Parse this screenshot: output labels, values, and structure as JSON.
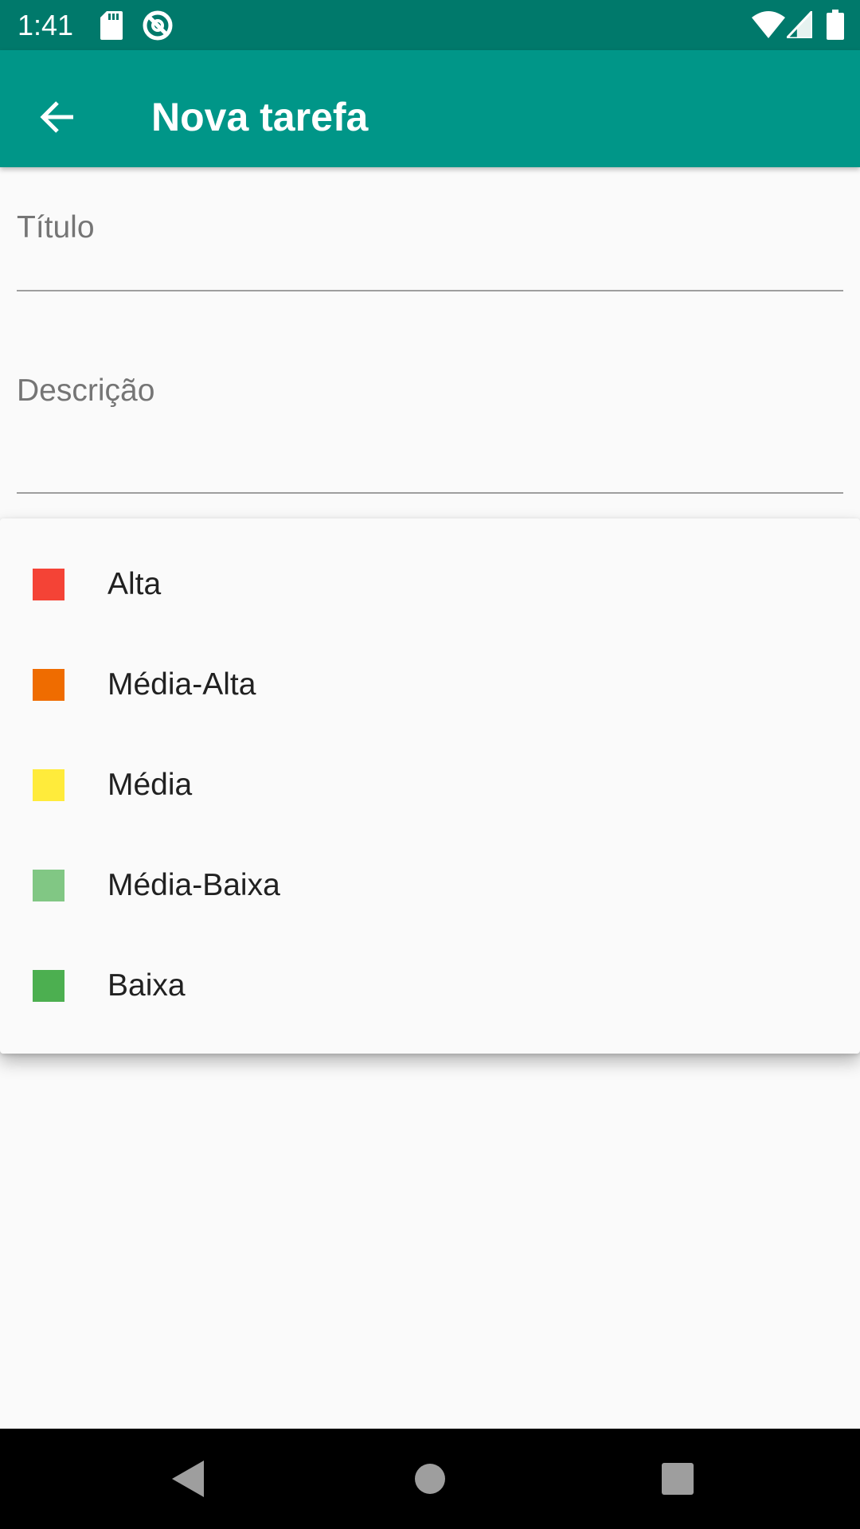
{
  "status_bar": {
    "time": "1:41",
    "icons": [
      "sd-card-icon",
      "sync-icon",
      "wifi-icon",
      "signal-icon",
      "battery-icon"
    ]
  },
  "app_bar": {
    "title": "Nova tarefa",
    "back_icon": "arrow-back-icon",
    "background": "#009688",
    "status_background": "#00796b"
  },
  "form": {
    "title_label": "Título",
    "description_label": "Descrição"
  },
  "priority_menu": {
    "items": [
      {
        "label": "Alta",
        "color": "#f44336"
      },
      {
        "label": "Média-Alta",
        "color": "#ef6c00"
      },
      {
        "label": "Média",
        "color": "#ffeb3b"
      },
      {
        "label": "Média-Baixa",
        "color": "#81c784"
      },
      {
        "label": "Baixa",
        "color": "#4caf50"
      }
    ]
  },
  "nav_bar": {
    "icons": [
      "back-triangle-icon",
      "home-circle-icon",
      "recents-square-icon"
    ]
  }
}
